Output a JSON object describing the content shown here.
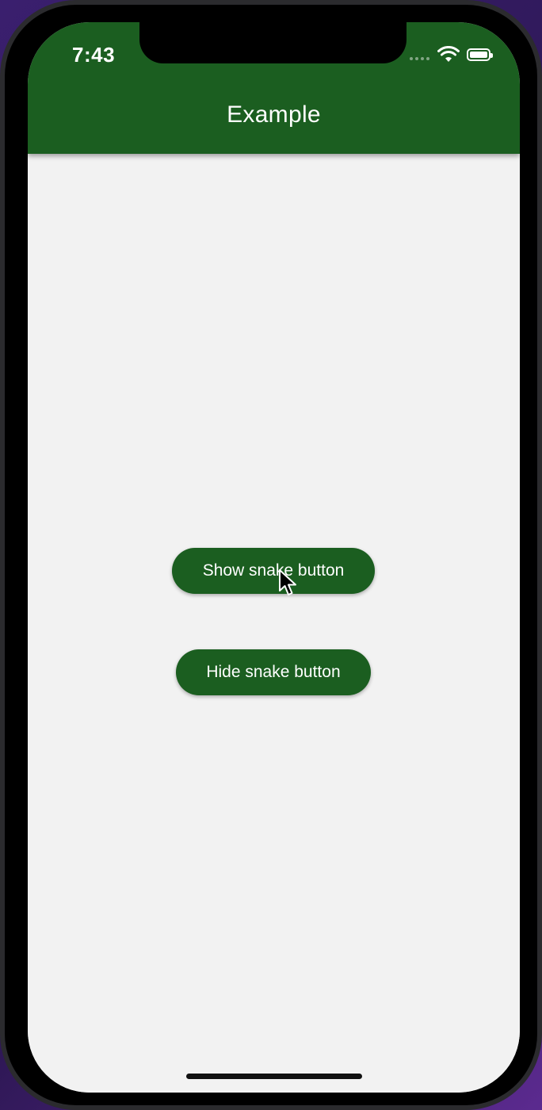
{
  "status_bar": {
    "time": "7:43"
  },
  "app_bar": {
    "title": "Example",
    "color": "#1b5e20"
  },
  "buttons": {
    "show_label": "Show snake button",
    "hide_label": "Hide snake button"
  },
  "colors": {
    "primary": "#1b5e20",
    "background": "#f2f2f2",
    "on_primary": "#ffffff"
  },
  "icons": {
    "wifi": "wifi-icon",
    "battery": "battery-icon",
    "cursor": "mouse-cursor-icon"
  }
}
